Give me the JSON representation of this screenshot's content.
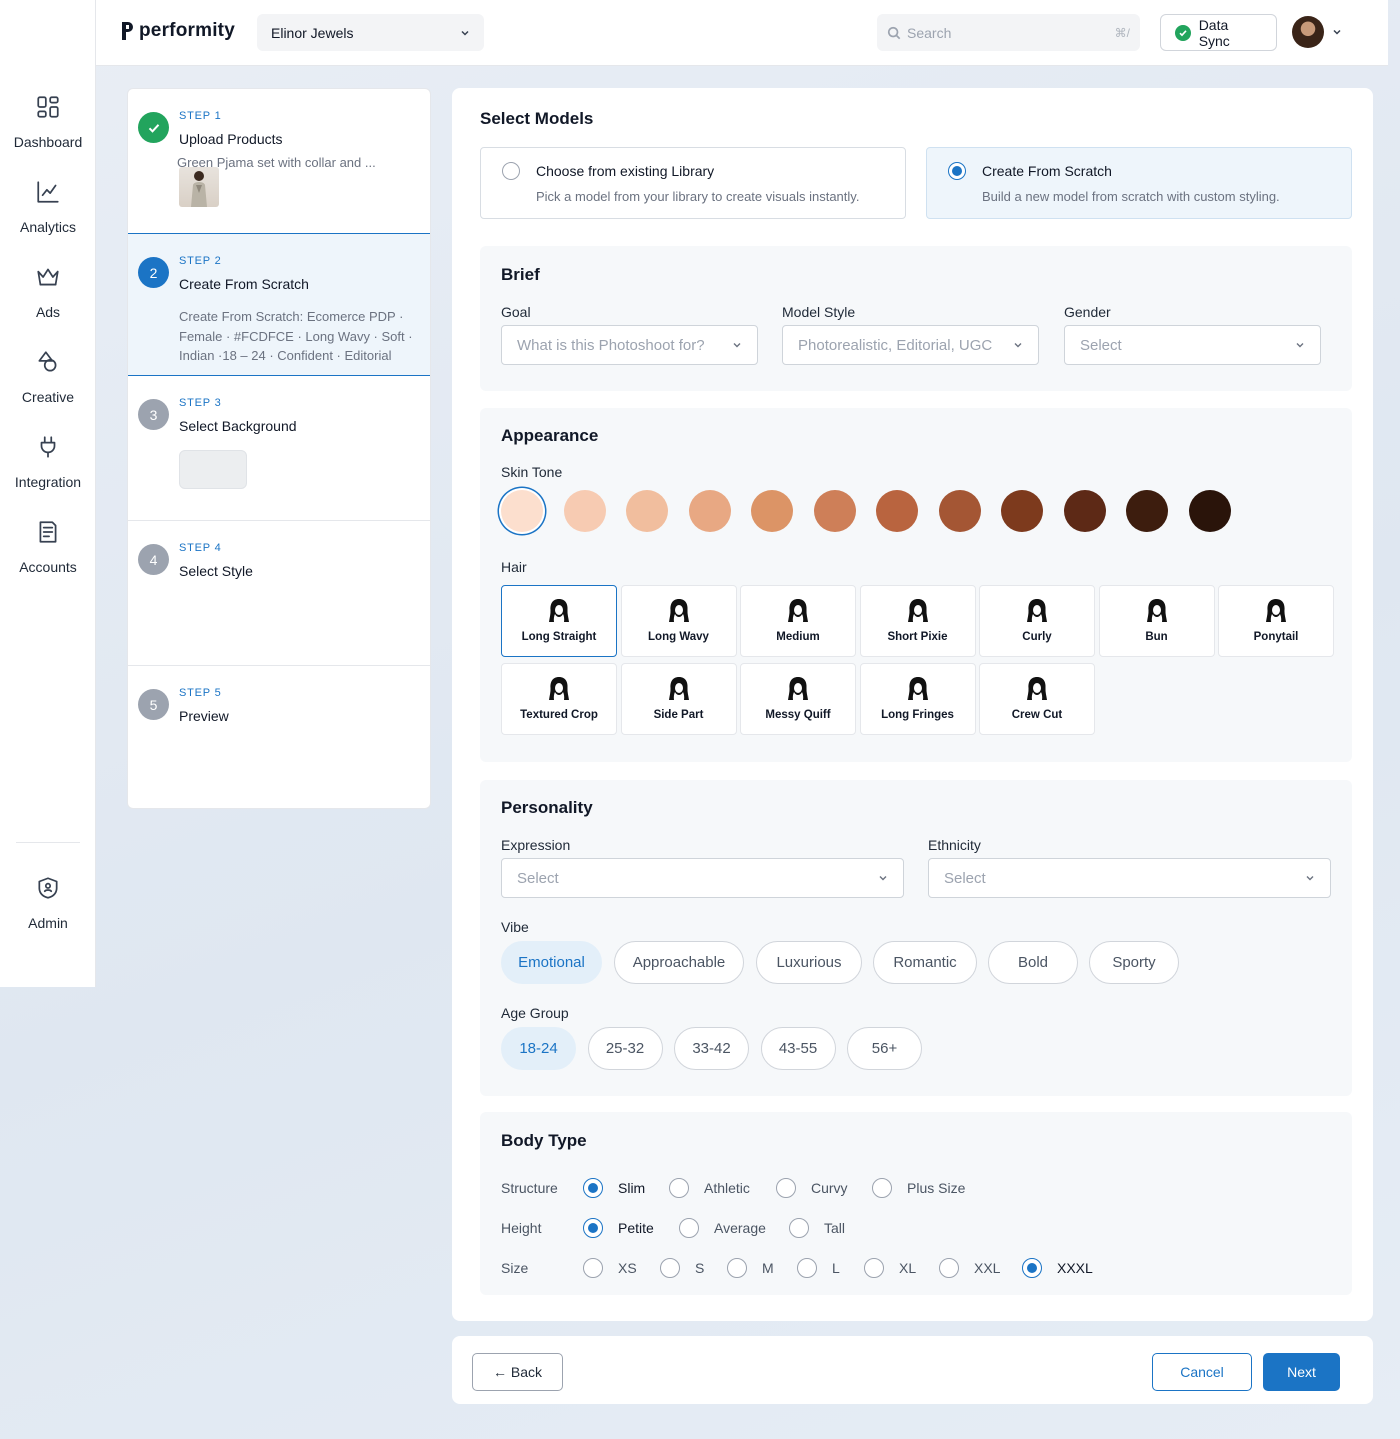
{
  "app": {
    "logo_text": "performity"
  },
  "nav": {
    "items": [
      {
        "label": "Dashboard",
        "icon": "dashboard-icon"
      },
      {
        "label": "Analytics",
        "icon": "chart-icon"
      },
      {
        "label": "Ads",
        "icon": "crown-icon"
      },
      {
        "label": "Creative",
        "icon": "shapes-icon"
      },
      {
        "label": "Integration",
        "icon": "plug-icon"
      },
      {
        "label": "Accounts",
        "icon": "document-icon"
      }
    ],
    "admin": {
      "label": "Admin",
      "icon": "shield-icon"
    }
  },
  "topbar": {
    "brand": "Elinor Jewels",
    "search_placeholder": "Search",
    "search_shortcut": "⌘/",
    "sync_label": "Data Sync"
  },
  "steps": [
    {
      "label": "STEP 1",
      "title": "Upload Products",
      "desc": "Green Pjama set with collar and ...",
      "status": "done"
    },
    {
      "label": "STEP 2",
      "title": "Create From Scratch",
      "desc": "Create From Scratch: Ecomerce PDP · Female · #FCDFCE · Long Wavy · Soft · Indian ·18 – 24 · Confident · Editorial",
      "status": "current",
      "number": "2"
    },
    {
      "label": "STEP 3",
      "title": "Select Background",
      "status": "todo",
      "number": "3"
    },
    {
      "label": "STEP 4",
      "title": "Select Style",
      "status": "todo",
      "number": "4"
    },
    {
      "label": "STEP 5",
      "title": "Preview",
      "status": "todo",
      "number": "5"
    }
  ],
  "select_models": {
    "title": "Select Models",
    "options": [
      {
        "title": "Choose from existing Library",
        "sub": "Pick a model from your library to create visuals instantly.",
        "selected": false
      },
      {
        "title": "Create From Scratch",
        "sub": "Build a new model from scratch with custom styling.",
        "selected": true
      }
    ]
  },
  "brief": {
    "title": "Brief",
    "fields": [
      {
        "label": "Goal",
        "placeholder": "What is this Photoshoot for?"
      },
      {
        "label": "Model Style",
        "placeholder": "Photorealistic, Editorial, UGC"
      },
      {
        "label": "Gender",
        "placeholder": "Select"
      }
    ]
  },
  "appearance": {
    "title": "Appearance",
    "skin_label": "Skin Tone",
    "skin_tones": [
      "#FCDFCE",
      "#F7CBB2",
      "#F1BE9E",
      "#E8A883",
      "#DC9466",
      "#CE7F58",
      "#B9643F",
      "#A45634",
      "#7D3A1D",
      "#5D2916",
      "#3D1D0E",
      "#2A140A"
    ],
    "skin_selected": 0,
    "hair_label": "Hair",
    "hair": [
      "Long Straight",
      "Long Wavy",
      "Medium",
      "Short Pixie",
      "Curly",
      "Bun",
      "Ponytail",
      "Textured Crop",
      "Side Part",
      "Messy Quiff",
      "Long Fringes",
      "Crew Cut"
    ],
    "hair_selected": 0
  },
  "personality": {
    "title": "Personality",
    "expression_label": "Expression",
    "expression_placeholder": "Select",
    "ethnicity_label": "Ethnicity",
    "ethnicity_placeholder": "Select",
    "vibe_label": "Vibe",
    "vibes": [
      "Emotional",
      "Approachable",
      "Luxurious",
      "Romantic",
      "Bold",
      "Sporty"
    ],
    "vibe_selected": 0,
    "age_label": "Age Group",
    "ages": [
      "18-24",
      "25-32",
      "33-42",
      "43-55",
      "56+"
    ],
    "age_selected": 0
  },
  "body_type": {
    "title": "Body Type",
    "rows": [
      {
        "label": "Structure",
        "options": [
          "Slim",
          "Athletic",
          "Curvy",
          "Plus Size"
        ],
        "selected": 0
      },
      {
        "label": "Height",
        "options": [
          "Petite",
          "Average",
          "Tall"
        ],
        "selected": 0
      },
      {
        "label": "Size",
        "options": [
          "XS",
          "S",
          "M",
          "L",
          "XL",
          "XXL",
          "XXXL"
        ],
        "selected": 6
      }
    ]
  },
  "footer": {
    "back": "← Back",
    "cancel": "Cancel",
    "next": "Next"
  },
  "colors": {
    "primary": "#1b74c5",
    "success": "#22a45d"
  }
}
